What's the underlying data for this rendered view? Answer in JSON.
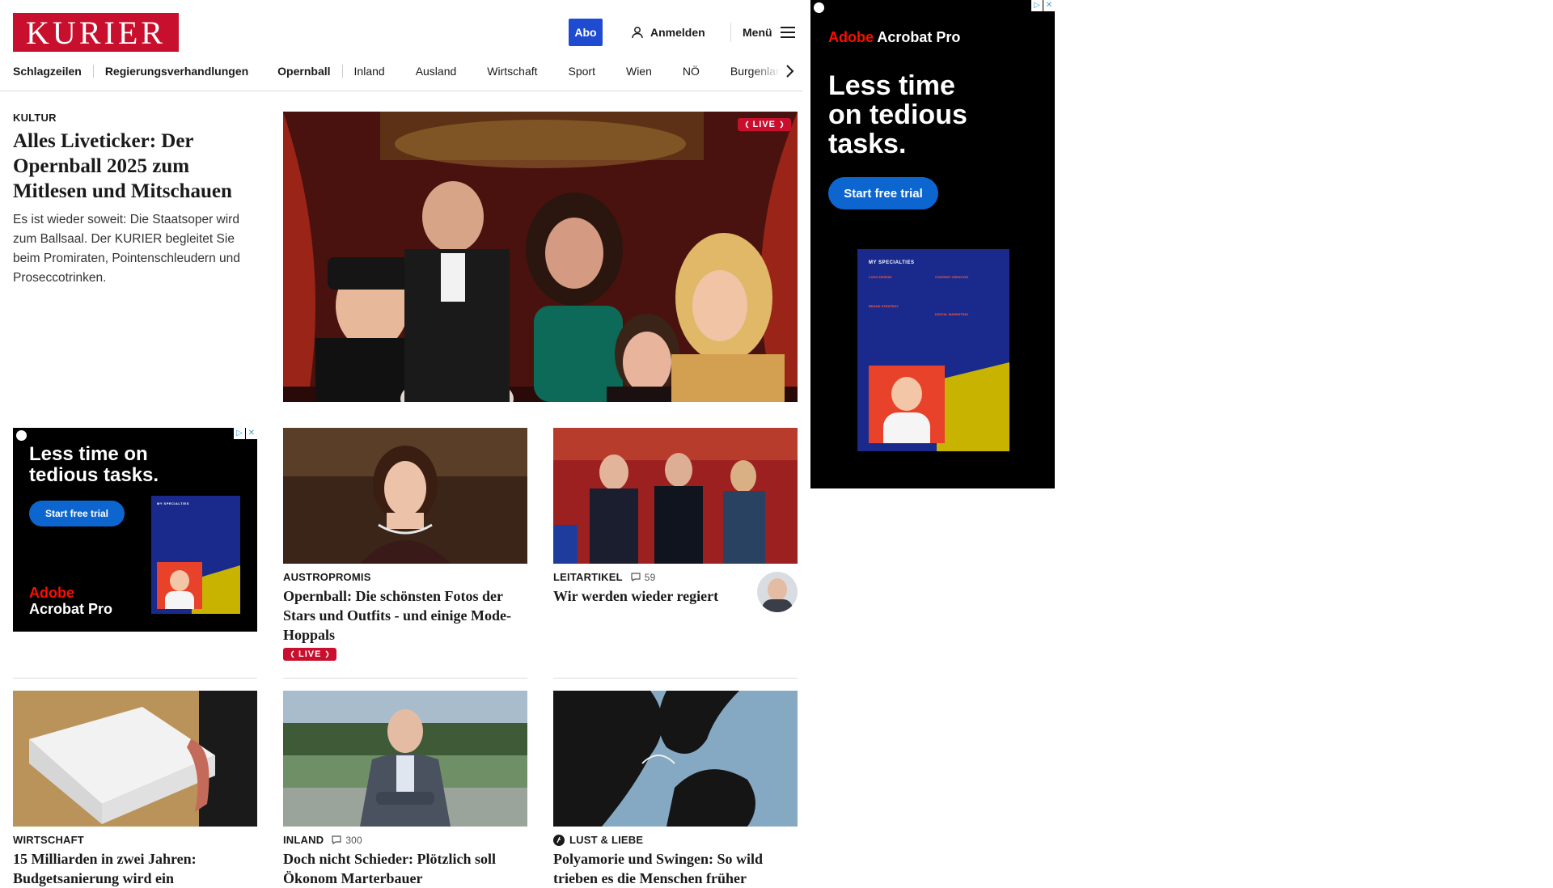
{
  "header": {
    "logo_text": "KURIER",
    "abo_label": "Abo",
    "login_label": "Anmelden",
    "menu_label": "Menü"
  },
  "nav": {
    "items": [
      "Schlagzeilen",
      "Regierungsverhandlungen",
      "Opernball",
      "Inland",
      "Ausland",
      "Wirtschaft",
      "Sport",
      "Wien",
      "NÖ",
      "Burgenland"
    ]
  },
  "lead": {
    "kicker": "KULTUR",
    "headline": "Alles Liveticker: Der Opernball 2025 zum Mitlesen und Mitschauen",
    "teaser": "Es ist wieder soweit: Die Staatsoper wird zum Ballsaal. Der KURIER begleitet Sie beim Promiraten, Pointenschleudern und Proseccotrinken.",
    "live_label": "LIVE"
  },
  "grid_row1": [
    {
      "kicker": "AUSTROPROMIS",
      "headline": "Opernball: Die schönsten Fotos der Stars und Outfits - und einige Mode-Hoppals",
      "live_label": "LIVE"
    },
    {
      "kicker": "LEITARTIKEL",
      "comments": "59",
      "headline": "Wir werden wieder regiert"
    }
  ],
  "grid_row2": [
    {
      "kicker": "WIRTSCHAFT",
      "headline": "15 Milliarden in zwei Jahren: Budgetsanierung wird ein"
    },
    {
      "kicker": "INLAND",
      "comments": "300",
      "headline": "Doch nicht Schieder: Plötzlich soll Ökonom Marterbauer"
    },
    {
      "kicker": "LUST & LIEBE",
      "headline": "Polyamorie und Swingen: So wild trieben es die Menschen früher"
    }
  ],
  "ad_inline": {
    "headline": "Less time on tedious tasks.",
    "cta": "Start free trial",
    "brand_line1": "Adobe",
    "brand_line2": "Acrobat Pro",
    "card_title": "MY SPECIALTIES"
  },
  "ad_sidebar": {
    "brand_red": "Adobe",
    "brand_white": "Acrobat Pro",
    "headline": "Less time on tedious tasks.",
    "cta": "Start free trial",
    "card_title": "MY SPECIALTIES",
    "card_items": [
      "LOGO DESIGN",
      "CONTENT CREATION",
      "BRAND STRATEGY",
      "DIGITAL MARKETING"
    ]
  },
  "colors": {
    "brand_red": "#c8102e",
    "abo_blue": "#1f4bd1",
    "ad_cta_blue": "#0d66d0",
    "adobe_red": "#fa0f00"
  }
}
